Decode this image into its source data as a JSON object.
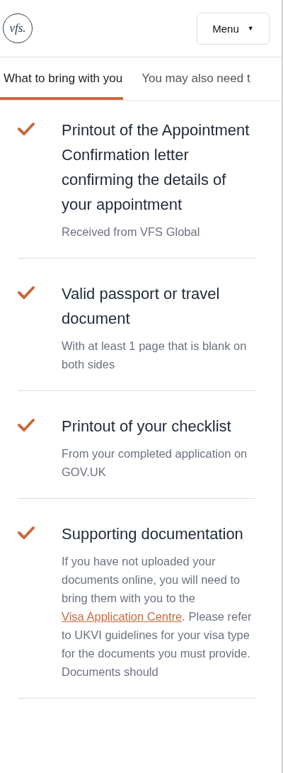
{
  "header": {
    "logo": "vfs.",
    "menu_button": "Menu",
    "menu_caret": "▼"
  },
  "tabs": [
    {
      "label": "What to bring with you",
      "selected": true
    },
    {
      "label": "You may also need t",
      "selected": false
    }
  ],
  "items": [
    {
      "checked": true,
      "title": "Printout of the Appointment Confirmation letter confirming the details of your appointment",
      "note": [
        {
          "kind": "text",
          "text": "Received from VFS Global"
        }
      ]
    },
    {
      "checked": true,
      "title": "Valid passport or travel document",
      "note": [
        {
          "kind": "text",
          "text": "With at least 1 page that is blank on both sides"
        }
      ]
    },
    {
      "checked": true,
      "title": "Printout of your checklist",
      "note": [
        {
          "kind": "text",
          "text": "From your completed application on GOV.UK"
        }
      ]
    },
    {
      "checked": true,
      "title": "Supporting documentation",
      "note": [
        {
          "kind": "text",
          "text": "If you have not uploaded your documents online, you will need to bring them with you to the "
        },
        {
          "kind": "link",
          "text": "Visa Application Centre"
        },
        {
          "kind": "text",
          "text": ". Please refer to UKVI guidelines for your visa type for the documents you must provide. Documents should"
        }
      ]
    }
  ]
}
